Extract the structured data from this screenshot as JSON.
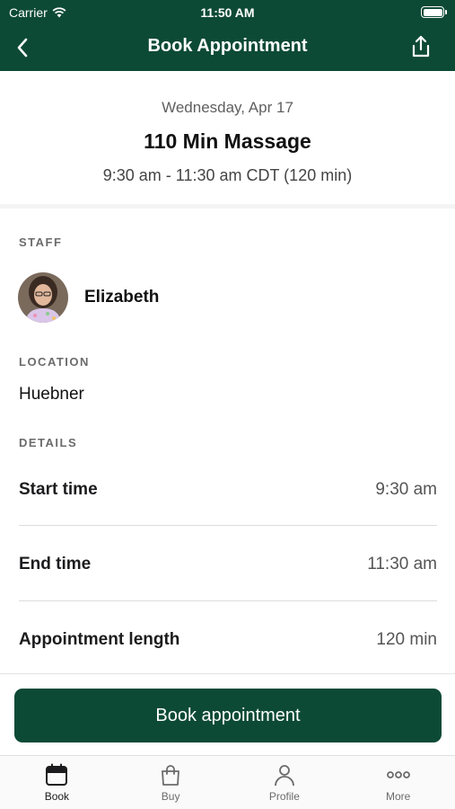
{
  "status_bar": {
    "carrier": "Carrier",
    "time": "11:50 AM"
  },
  "nav": {
    "title": "Book Appointment",
    "back_icon": "chevron-left-icon",
    "share_icon": "share-icon"
  },
  "summary": {
    "date": "Wednesday, Apr 17",
    "service": "110 Min Massage",
    "time_range": "9:30 am - 11:30 am CDT (120 min)"
  },
  "staff": {
    "label": "STAFF",
    "name": "Elizabeth"
  },
  "location": {
    "label": "LOCATION",
    "value": "Huebner"
  },
  "details": {
    "label": "DETAILS",
    "rows": [
      {
        "key": "Start time",
        "value": "9:30 am"
      },
      {
        "key": "End time",
        "value": "11:30 am"
      },
      {
        "key": "Appointment length",
        "value": "120 min"
      }
    ]
  },
  "cta": {
    "label": "Book appointment"
  },
  "tabs": [
    {
      "label": "Book",
      "icon": "calendar-icon",
      "active": true
    },
    {
      "label": "Buy",
      "icon": "bag-icon",
      "active": false
    },
    {
      "label": "Profile",
      "icon": "person-icon",
      "active": false
    },
    {
      "label": "More",
      "icon": "more-dots-icon",
      "active": false
    }
  ],
  "colors": {
    "brand": "#0d4a36"
  }
}
